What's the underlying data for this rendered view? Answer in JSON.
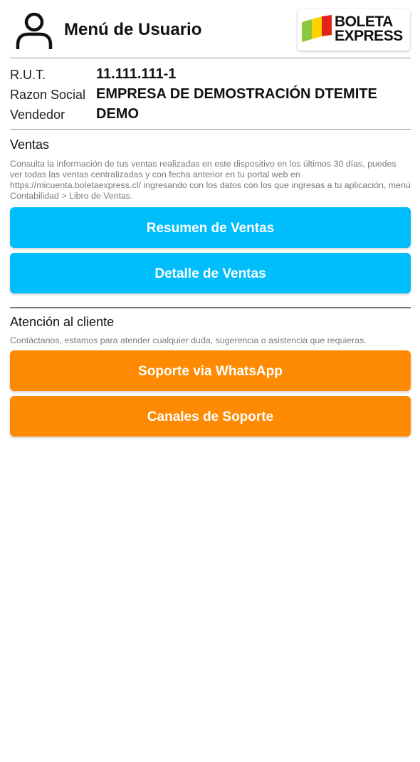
{
  "header": {
    "title": "Menú de Usuario",
    "logo_line1": "BOLETA",
    "logo_line2": "EXPRESS",
    "user_icon": "user-icon"
  },
  "account": {
    "rows": [
      {
        "label": "R.U.T.",
        "value": "11.111.111-1"
      },
      {
        "label": "Razon Social",
        "value": "EMPRESA DE DEMOSTRACIÓN DTEMITE"
      },
      {
        "label": "Vendedor",
        "value": "DEMO"
      }
    ]
  },
  "ventas": {
    "title": "Ventas",
    "description": "Consulta la información de tus ventas realizadas en este dispositivo en los últimos 30 días, puedes ver todas las ventas centralizadas y con fecha anterior en tu portal web en https://micuenta.boletaexpress.cl/ ingresando con los datos con los que ingresas a tu aplicación, menú Contabilidad > Libro de Ventas.",
    "buttons": [
      {
        "label": "Resumen de Ventas"
      },
      {
        "label": "Detalle de Ventas"
      }
    ]
  },
  "atencion": {
    "title": "Atención al cliente",
    "description": "Contáctanos, estamos para atender cualquier duda, sugerencia o asistencia que requieras.",
    "buttons": [
      {
        "label": "Soporte via WhatsApp"
      },
      {
        "label": "Canales de Soporte"
      }
    ]
  },
  "colors": {
    "primary_button": "#00bdfc",
    "support_button": "#fd8a02",
    "logo_green": "#8dc63f",
    "logo_yellow": "#ffd200",
    "logo_red": "#e2231a"
  }
}
